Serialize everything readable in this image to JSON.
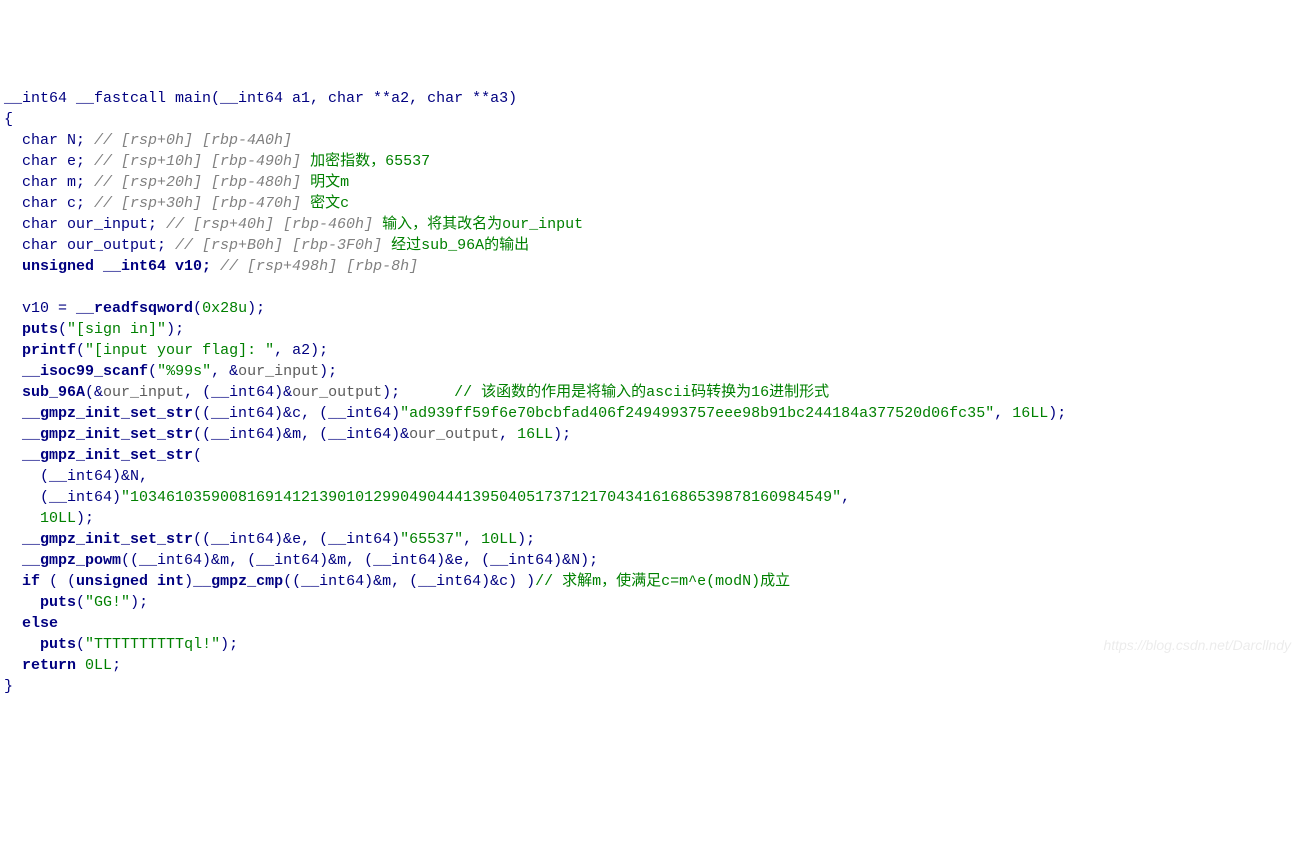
{
  "line1_signature": "__int64 __fastcall main(__int64 a1, char **a2, char **a3)",
  "line2_brace": "{",
  "decl_N_prefix": "  char N; ",
  "decl_N_comment": "// [rsp+0h] [rbp-4A0h]",
  "decl_e_prefix": "  char e; ",
  "decl_e_comment1": "// [rsp+10h] [rbp-490h]",
  "decl_e_comment2": " 加密指数，65537",
  "decl_m_prefix": "  char m; ",
  "decl_m_comment1": "// [rsp+20h] [rbp-480h]",
  "decl_m_comment2": " 明文m",
  "decl_c_prefix": "  char c; ",
  "decl_c_comment1": "// [rsp+30h] [rbp-470h]",
  "decl_c_comment2": " 密文c",
  "decl_our_input_prefix": "  char our_input; ",
  "decl_our_input_comment1": "// [rsp+40h] [rbp-460h]",
  "decl_our_input_comment2": " 输入，将其改名为our_input",
  "decl_our_output_prefix": "  char our_output; ",
  "decl_our_output_comment1": "// [rsp+B0h] [rbp-3F0h]",
  "decl_our_output_comment2": " 经过sub_96A的输出",
  "decl_v10_prefix": "  unsigned __int64 v10; ",
  "decl_v10_comment": "// [rsp+498h] [rbp-8h]",
  "blank": "",
  "stmt_v10": "  v10 = __readfsqword(0x28u);",
  "stmt_v10_call": "__readfsqword",
  "stmt_v10_arg": "0x28u",
  "puts_signin_pre": "  puts(",
  "puts_signin_str": "\"[sign in]\"",
  "puts_signin_post": ");",
  "printf_pre": "  printf(",
  "printf_str": "\"[input your flag]: \"",
  "printf_post": ", a2);",
  "scanf_pre": "  __isoc99_scanf(",
  "scanf_call": "__isoc99_scanf",
  "scanf_str": "\"%99s\"",
  "scanf_post": ", &our_input);",
  "scanf_var": "our_input",
  "sub96a_full_pre": "  sub_96A(&",
  "sub96a_var1": "our_input",
  "sub96a_mid1": ", (__int64)&",
  "sub96a_var2": "our_output",
  "sub96a_post": ");      ",
  "sub96a_comment": "// 该函数的作用是将输入的ascii码转换为16进制形式",
  "gmpz_c_pre": "  __gmpz_init_set_str((__int64)&c, (__int64)",
  "gmpz_c_str": "\"ad939ff59f6e70bcbfad406f2494993757eee98b91bc244184a377520d06fc35\"",
  "gmpz_c_post": ", 16LL);",
  "gmpz_m_pre": "  __gmpz_init_set_str((__int64)&m, (__int64)&",
  "gmpz_m_var": "our_output",
  "gmpz_m_post": ", 16LL);",
  "gmpz_N_line1": "  __gmpz_init_set_str(",
  "gmpz_N_line2": "    (__int64)&N,",
  "gmpz_N_line3_pre": "    (__int64)",
  "gmpz_N_str": "\"103461035900816914121390101299049044413950405173712170434161686539878160984549\"",
  "gmpz_N_line3_post": ",",
  "gmpz_N_line4": "    10LL);",
  "gmpz_e_pre": "  __gmpz_init_set_str((__int64)&e, (__int64)",
  "gmpz_e_str": "\"65537\"",
  "gmpz_e_post": ", 10LL);",
  "gmpz_powm": "  __gmpz_powm((__int64)&m, (__int64)&m, (__int64)&e, (__int64)&N);",
  "if_line_pre": "  if ( (unsigned int)__gmpz_cmp((__int64)&m, (__int64)&c) )",
  "if_comment": "// 求解m，使满足c=m^e(modN)成立",
  "puts_gg_pre": "    puts(",
  "puts_gg_str": "\"GG!\"",
  "puts_gg_post": ");",
  "else_line": "  else",
  "puts_tql_pre": "    puts(",
  "puts_tql_str": "\"TTTTTTTTTTql!\"",
  "puts_tql_post": ");",
  "return_line": "  return 0LL;",
  "close_brace": "}",
  "watermark": "https://blog.csdn.net/Darcllndy"
}
